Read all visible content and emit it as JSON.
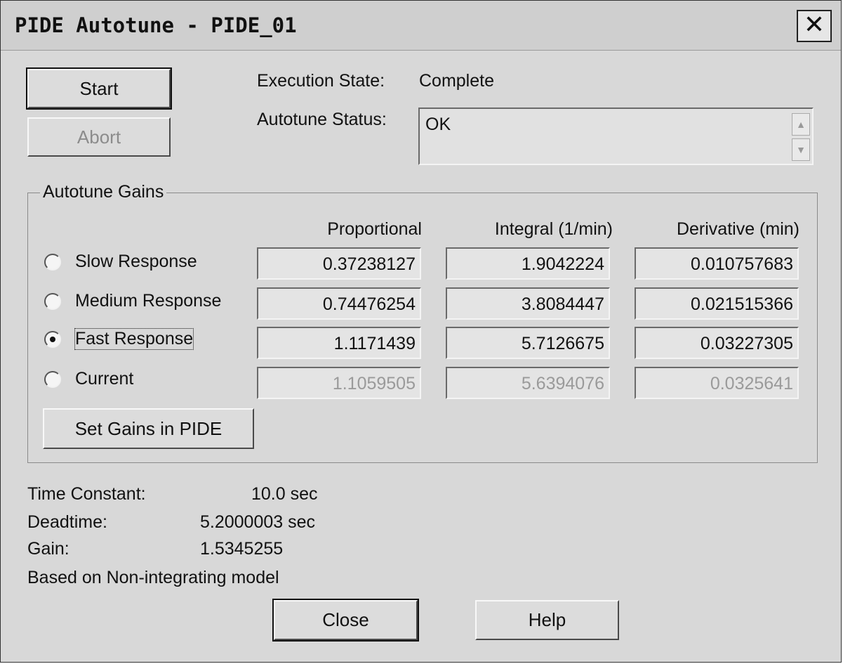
{
  "window": {
    "title": "PIDE Autotune - PIDE_01",
    "close_glyph": "✕"
  },
  "buttons": {
    "start": "Start",
    "abort": "Abort",
    "set_gains": "Set Gains in PIDE",
    "close": "Close",
    "help": "Help"
  },
  "state": {
    "execution_label": "Execution State:",
    "execution_value": "Complete",
    "status_label": "Autotune Status:",
    "status_value": "OK"
  },
  "gains": {
    "group_title": "Autotune Gains",
    "columns": [
      "Proportional",
      "Integral (1/min)",
      "Derivative (min)"
    ],
    "rows": [
      {
        "label": "Slow Response",
        "selected": false,
        "values": [
          "0.37238127",
          "1.9042224",
          "0.010757683"
        ]
      },
      {
        "label": "Medium Response",
        "selected": false,
        "values": [
          "0.74476254",
          "3.8084447",
          "0.021515366"
        ]
      },
      {
        "label": "Fast Response",
        "selected": true,
        "values": [
          "1.1171439",
          "5.7126675",
          "0.03227305"
        ]
      },
      {
        "label": "Current",
        "selected": false,
        "values": [
          "1.1059505",
          "5.6394076",
          "0.0325641"
        ]
      }
    ]
  },
  "model": {
    "time_constant_label": "Time Constant:",
    "time_constant_value": "10.0 sec",
    "deadtime_label": "Deadtime:",
    "deadtime_value": "5.2000003 sec",
    "gain_label": "Gain:",
    "gain_value": "1.5345255",
    "note": "Based on Non-integrating model"
  }
}
